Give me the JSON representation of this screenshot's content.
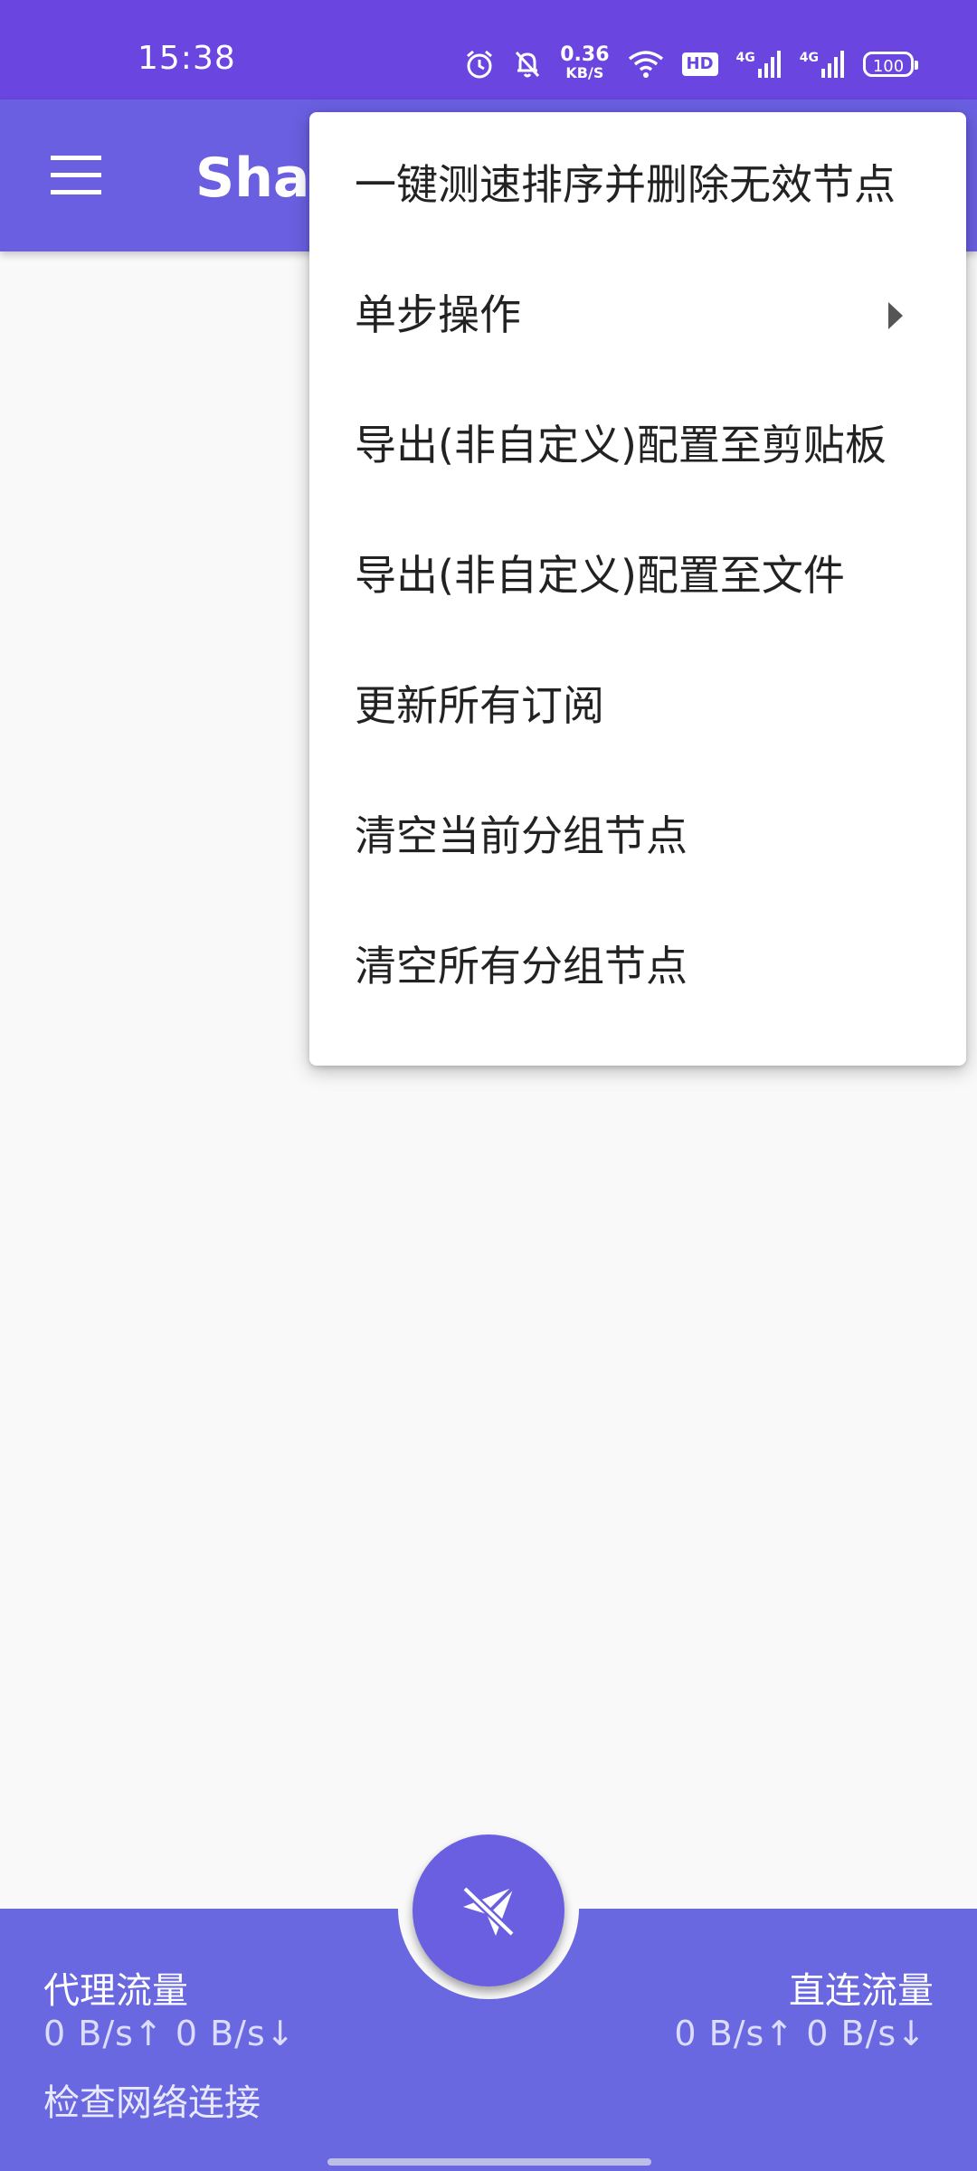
{
  "status_bar": {
    "time": "15:38",
    "net_speed_value": "0.36",
    "net_speed_unit": "KB/S",
    "hd_badge": "HD",
    "signal_1": "4G",
    "signal_2": "4G",
    "battery": "100"
  },
  "app_bar": {
    "title": "Shad"
  },
  "overflow_menu": {
    "items": [
      {
        "label": "一键测速排序并删除无效节点"
      },
      {
        "label": "单步操作"
      },
      {
        "label": "导出(非自定义)配置至剪贴板"
      },
      {
        "label": "导出(非自定义)配置至文件"
      },
      {
        "label": "更新所有订阅"
      },
      {
        "label": "清空当前分组节点"
      },
      {
        "label": "清空所有分组节点"
      }
    ]
  },
  "bottom_bar": {
    "proxy_label": "代理流量",
    "proxy_value": "0 B/s↑  0 B/s↓",
    "direct_label": "直连流量",
    "direct_value": "0 B/s↑  0 B/s↓",
    "check_link": "检查网络连接"
  },
  "colors": {
    "status_bar": "#6a45e0",
    "primary": "#6a5fe1",
    "bottom_bar": "#6a68e0",
    "background": "#f9f9f9"
  },
  "icons": {
    "menu": "hamburger-menu-icon",
    "fab": "paper-plane-off-icon",
    "submenu": "triangle-right-icon"
  }
}
